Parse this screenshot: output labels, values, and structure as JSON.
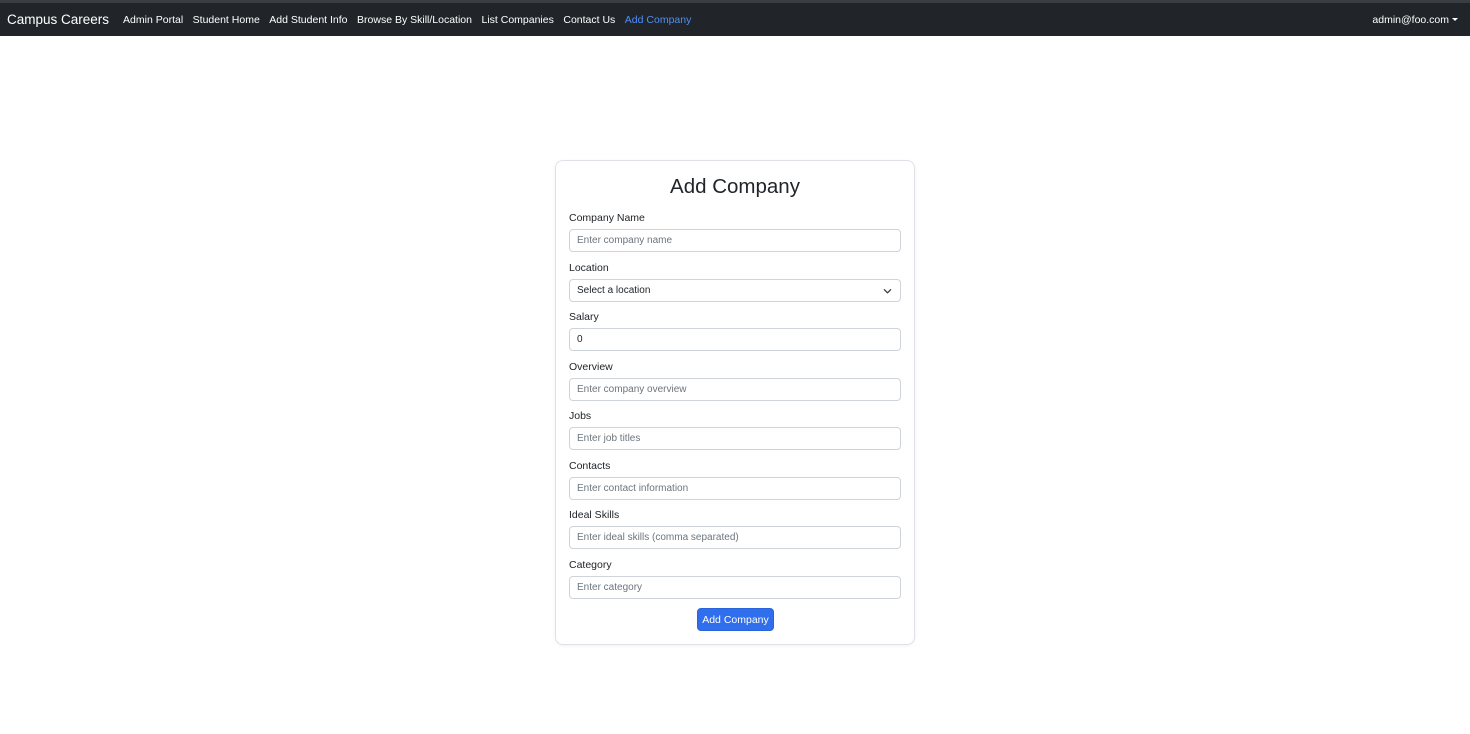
{
  "navbar": {
    "brand": "Campus Careers",
    "links": [
      {
        "label": "Admin Portal"
      },
      {
        "label": "Student Home"
      },
      {
        "label": "Add Student Info"
      },
      {
        "label": "Browse By Skill/Location"
      },
      {
        "label": "List Companies"
      },
      {
        "label": "Contact Us"
      },
      {
        "label": "Add Company"
      }
    ],
    "active_link": "Add Company",
    "user": "admin@foo.com",
    "user_icon": "caret-down-icon"
  },
  "form": {
    "title": "Add Company",
    "fields": {
      "company_name": {
        "label": "Company Name",
        "placeholder": "Enter company name",
        "value": ""
      },
      "location": {
        "label": "Location",
        "selected": "Select a location"
      },
      "salary": {
        "label": "Salary",
        "value": "0"
      },
      "overview": {
        "label": "Overview",
        "placeholder": "Enter company overview",
        "value": ""
      },
      "jobs": {
        "label": "Jobs",
        "placeholder": "Enter job titles",
        "value": ""
      },
      "contacts": {
        "label": "Contacts",
        "placeholder": "Enter contact information",
        "value": ""
      },
      "ideal_skills": {
        "label": "Ideal Skills",
        "placeholder": "Enter ideal skills (comma separated)",
        "value": ""
      },
      "category": {
        "label": "Category",
        "placeholder": "Enter category",
        "value": ""
      }
    },
    "submit_label": "Add Company"
  },
  "colors": {
    "navbar_bg": "#212529",
    "active_link": "#4d8ef7",
    "primary_button": "#2f6fed"
  }
}
